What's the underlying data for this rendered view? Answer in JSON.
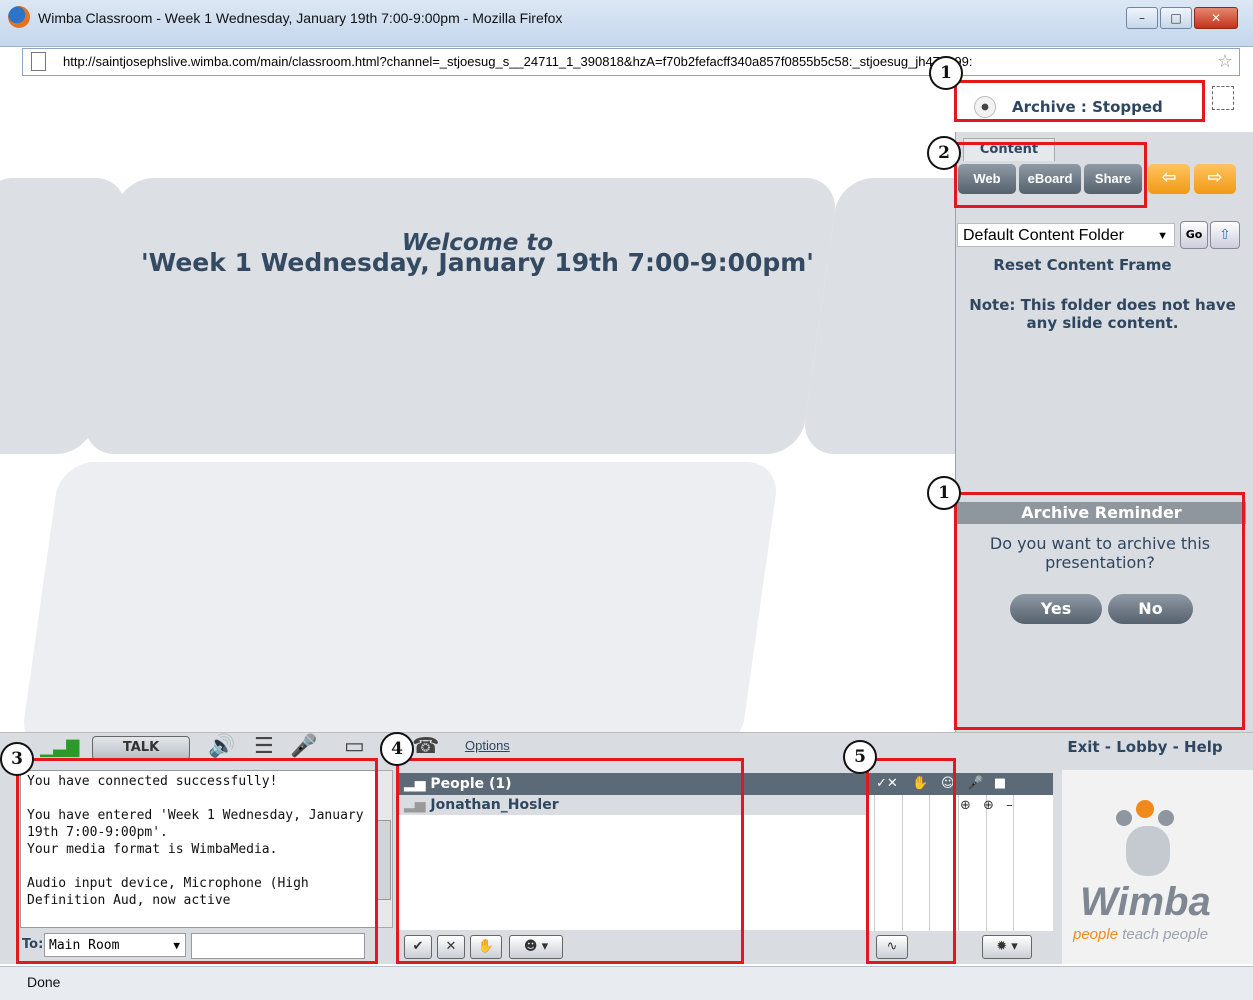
{
  "window": {
    "title": "Wimba Classroom - Week 1 Wednesday, January 19th 7:00-9:00pm - Mozilla Firefox",
    "url": "http://saintjosephslive.wimba.com/main/classroom.html?channel=_stjoesug_s__24711_1_390818&hzA=f70b2fefacff340a857f0855b5c58:_stjoesug_jh475399:",
    "min_label": "–",
    "max_label": "□",
    "close_label": "✕"
  },
  "stage": {
    "welcome_line1": "Welcome to",
    "welcome_line2": "'Week 1 Wednesday, January 19th 7:00-9:00pm'"
  },
  "archive": {
    "status": "Archive : Stopped"
  },
  "content": {
    "tab_label": "Content",
    "buttons": [
      "Web",
      "eBoard",
      "Share"
    ],
    "prev_label": "⇦",
    "next_label": "⇨",
    "folder_value": "Default Content Folder",
    "go_label": "Go",
    "reset_label": "Reset Content Frame",
    "note": "Note: This folder does not have any slide content."
  },
  "reminder": {
    "title": "Archive Reminder",
    "question": "Do you want to archive this presentation?",
    "yes": "Yes",
    "no": "No"
  },
  "toolbar": {
    "talk_label": "TALK",
    "options_label": "Options",
    "nav": "Exit - Lobby - Help"
  },
  "chat": {
    "lines": [
      "You have connected successfully!",
      "You have entered 'Week 1 Wednesday, January 19th 7:00-9:00pm'.",
      "Your media format is WimbaMedia.",
      "Audio input device, Microphone (High Definition Aud, now active"
    ],
    "to_label": "To:",
    "to_value": "Main Room"
  },
  "people": {
    "header": "People (1)",
    "members": [
      "Jonathan_Hosler"
    ]
  },
  "logo": {
    "word": "Wimba",
    "tag_highlight": "people",
    "tag_rest": " teach people"
  },
  "statusbar": {
    "text": "Done"
  },
  "callouts": [
    "1",
    "2",
    "1",
    "3",
    "4",
    "5"
  ],
  "colors": {
    "annotation_red": "#e3171d",
    "accent_orange": "#f09a14",
    "text_navy": "#2f4660"
  }
}
